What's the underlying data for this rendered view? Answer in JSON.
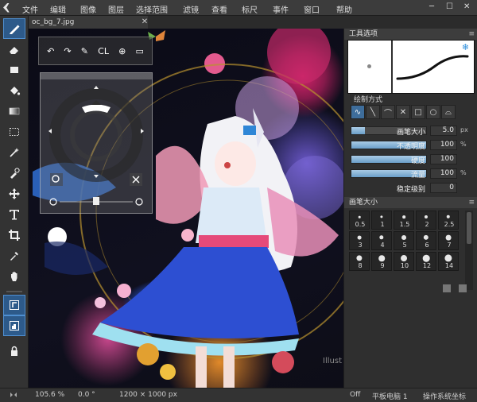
{
  "menubar": {
    "items": [
      "文件",
      "编辑",
      "图像",
      "图层",
      "选择范围",
      "滤镜",
      "查看",
      "标尺",
      "事件",
      "窗口",
      "帮助"
    ]
  },
  "window_controls": {
    "minimize": "─",
    "maximize": "☐",
    "close": "✕"
  },
  "document_tab": {
    "filename": "oc_bg_7.jpg",
    "close": "✕"
  },
  "float_toolbar": {
    "undo": "↶",
    "redo": "↷",
    "pen": "✎",
    "clear": "CL",
    "target": "⊕",
    "layout": "▭"
  },
  "tool_options": {
    "title": "工具选项",
    "menu": "≡",
    "snowflake": "❄",
    "draw_mode_label": "绘制方式",
    "shapes": [
      "∿",
      "╲",
      "⌒",
      "✕",
      "□",
      "○",
      "⌓"
    ],
    "params": [
      {
        "label": "画笔大小",
        "value": "5.0",
        "unit": "px",
        "fill": 0.18
      },
      {
        "label": "不透明度",
        "value": "100",
        "unit": "%",
        "fill": 1.0
      },
      {
        "label": "硬度",
        "value": "100",
        "unit": "",
        "fill": 1.0
      },
      {
        "label": "流量",
        "value": "100",
        "unit": "%",
        "fill": 1.0
      },
      {
        "label": "稳定级别",
        "value": "0",
        "unit": "",
        "fill": 0
      }
    ]
  },
  "brush_size": {
    "title": "画笔大小",
    "menu": "≡",
    "sizes": [
      "0.5",
      "1",
      "1.5",
      "2",
      "2.5",
      "3",
      "4",
      "5",
      "6",
      "7",
      "8",
      "9",
      "10",
      "12",
      "14"
    ]
  },
  "statusbar": {
    "zoom": "105.6 %",
    "rotation": "0.0 °",
    "dimensions": "1200 × 1000 px",
    "off": "Off",
    "tablet": "平板电脑 1",
    "coords": "操作系统坐标"
  },
  "watermark": "Illust",
  "colors": {
    "accent": "#3e6d9b",
    "panel": "#2f2f2f",
    "menubar": "#3c3c3c"
  }
}
